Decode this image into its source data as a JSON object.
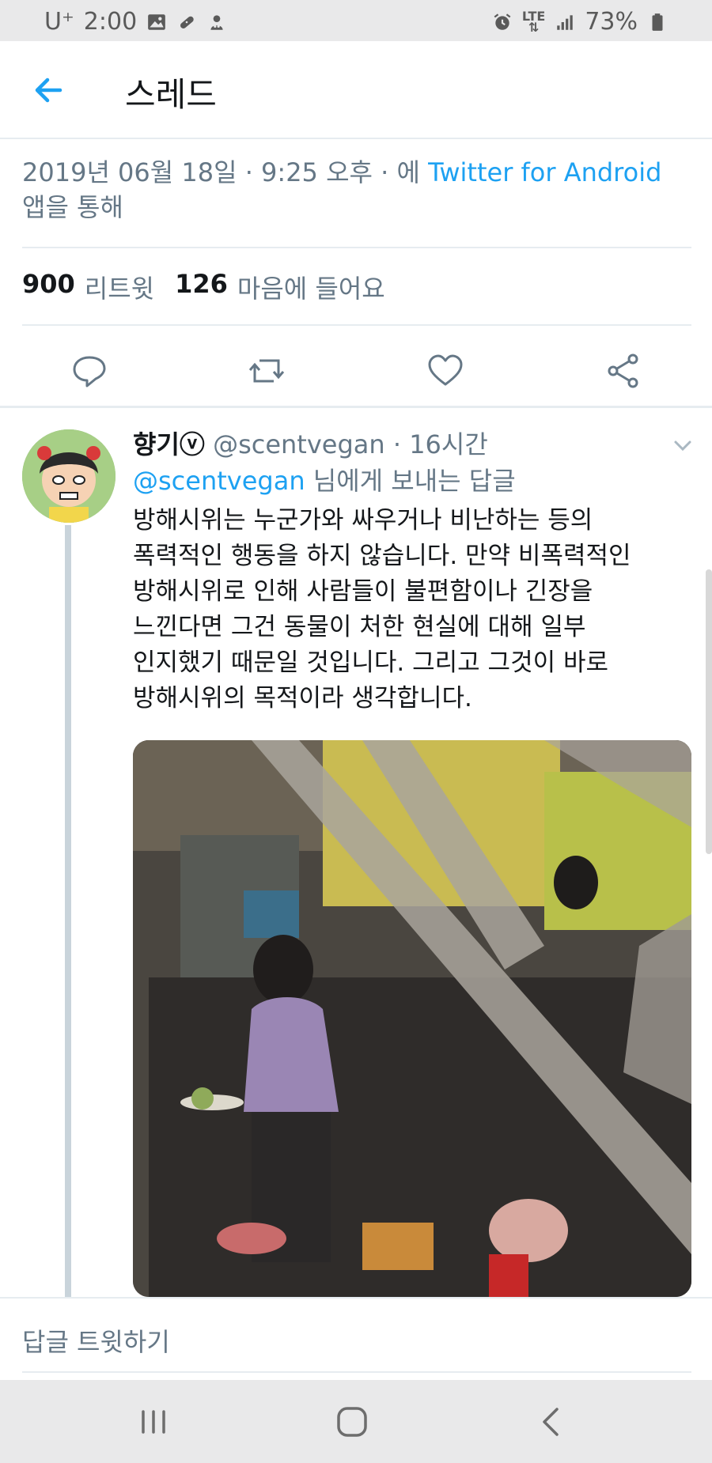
{
  "status_bar": {
    "carrier": "U⁺",
    "time": "2:00",
    "lte": [
      "LTE",
      "⇅"
    ],
    "battery": "73%",
    "left_icons": [
      "image-icon",
      "bandage-icon",
      "notification-icon"
    ],
    "right_icons": [
      "alarm-icon",
      "lte-icon",
      "signal-icon",
      "battery-icon"
    ]
  },
  "header": {
    "title": "스레드"
  },
  "tweet": {
    "date": "2019년 06월 18일 · 9:25 오후 · 에",
    "source": "Twitter for Android",
    "source_suffix": "앱을 통해",
    "retweets_count": "900",
    "retweets_label": "리트윗",
    "likes_count": "126",
    "likes_label": "마음에 들어요"
  },
  "reply": {
    "name": "향기ⓥ",
    "handle": "@scentvegan",
    "time": "· 16시간",
    "reply_to_handle": "@scentvegan",
    "reply_to_suffix": "님에게 보내는 답글",
    "body_lines": [
      "방해시위는 누군가와 싸우거나 비난하는 등의",
      "폭력적인 행동을 하지 않습니다. 만약 비폭력적인",
      "방해시위로 인해 사람들이 불편함이나 긴장을",
      "느낀다면 그건 동물이 처한 현실에 대해 일부",
      "인지했기 때문일 것입니다. 그리고 그것이 바로",
      "방해시위의 목적이라 생각합니다."
    ]
  },
  "reply_bar": {
    "placeholder": "답글 트윗하기"
  },
  "colors": {
    "accent": "#1da1f2",
    "secondary_text": "#657786",
    "primary_text": "#14171a",
    "divider": "#e6ecf0"
  }
}
